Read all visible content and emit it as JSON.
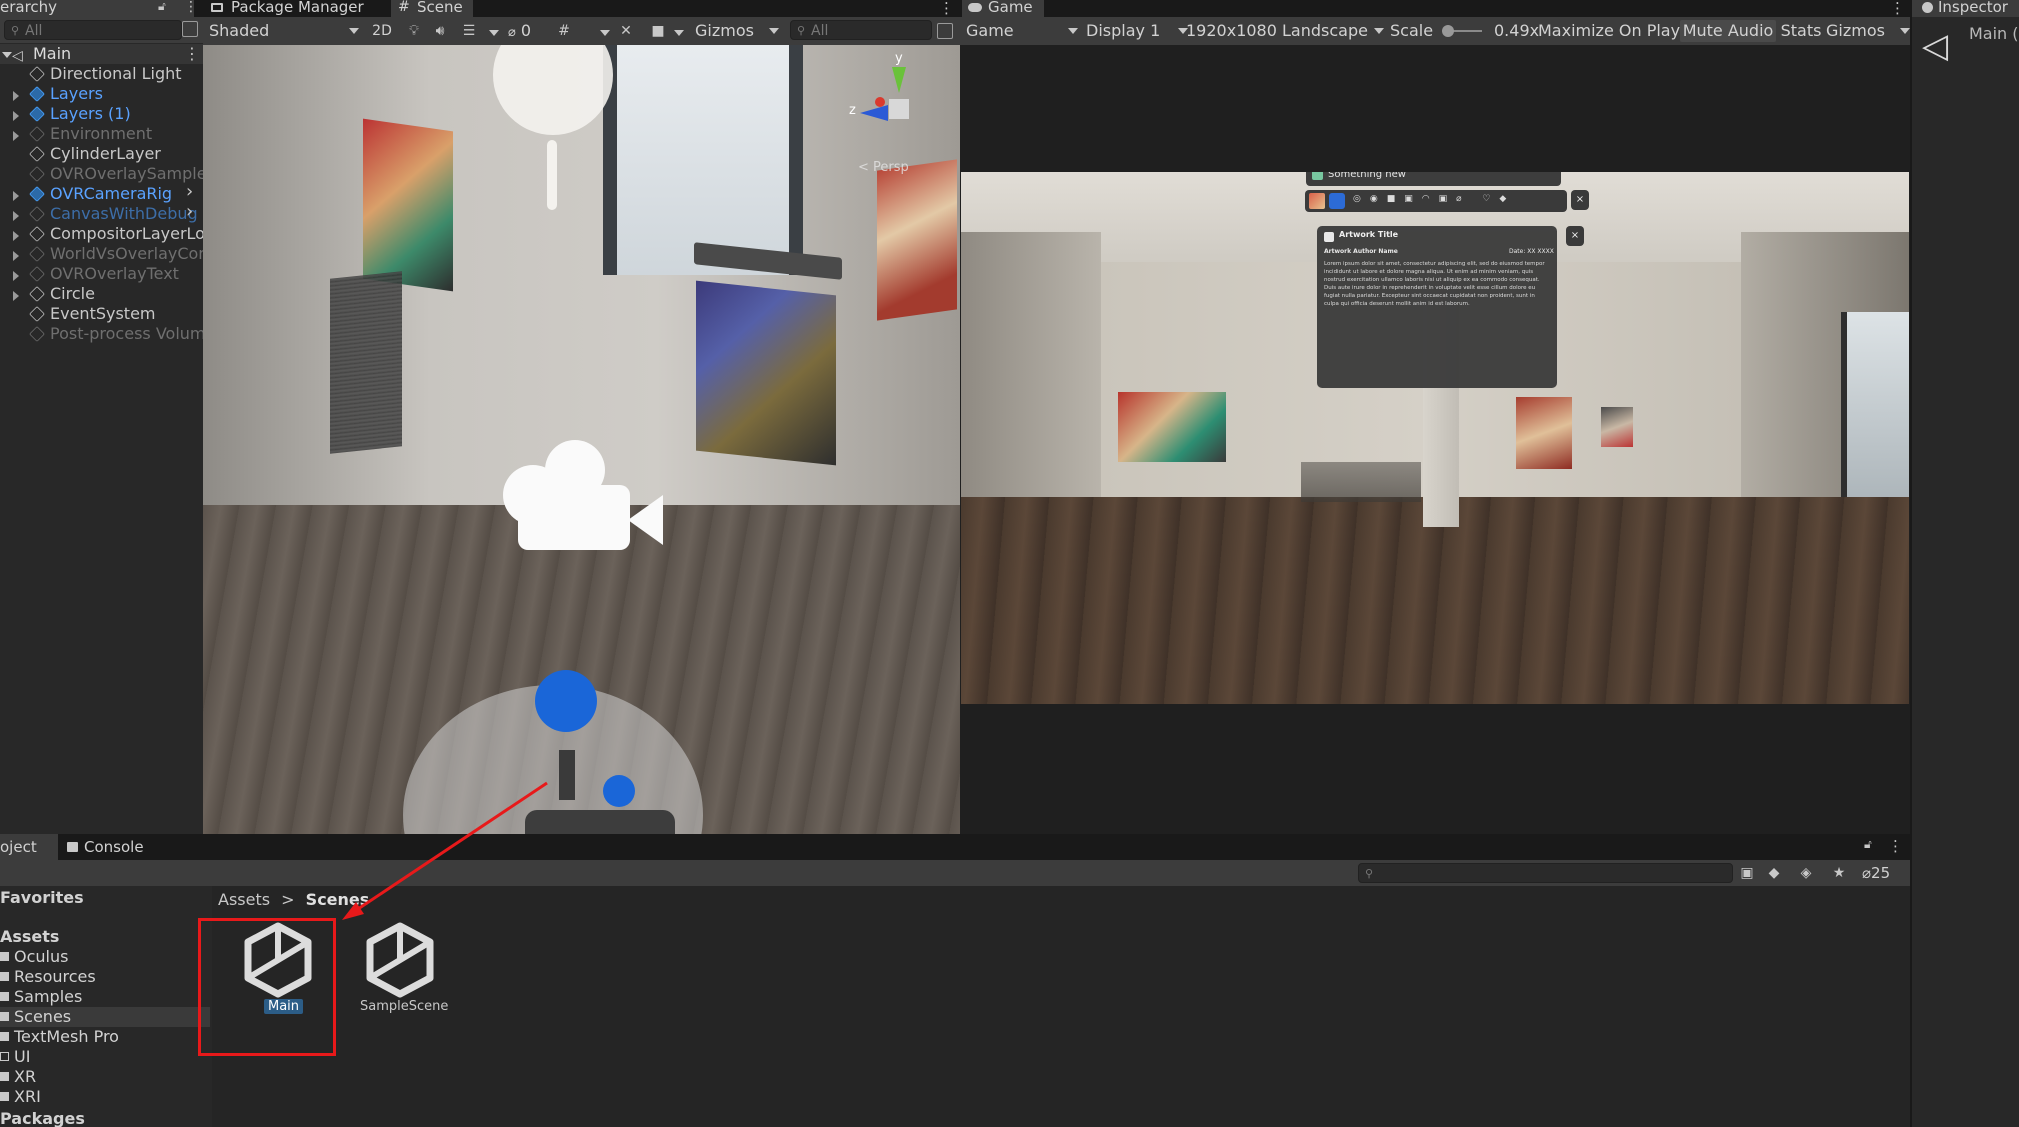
{
  "hierarchy": {
    "tab_label": "erarchy",
    "search_placeholder": "All",
    "scene_name": "Main",
    "items": [
      {
        "label": "Directional Light",
        "style": "normal",
        "foldout": false
      },
      {
        "label": "Layers",
        "style": "blue",
        "foldout": true
      },
      {
        "label": "Layers (1)",
        "style": "blue",
        "foldout": true
      },
      {
        "label": "Environment",
        "style": "dim",
        "foldout": true
      },
      {
        "label": "CylinderLayer",
        "style": "normal",
        "foldout": false
      },
      {
        "label": "OVROverlaySampleL",
        "style": "dim",
        "foldout": false
      },
      {
        "label": "OVRCameraRig",
        "style": "blue",
        "foldout": true
      },
      {
        "label": "CanvasWithDebug",
        "style": "bluedim",
        "foldout": true
      },
      {
        "label": "CompositorLayerLoa",
        "style": "normal",
        "foldout": true
      },
      {
        "label": "WorldVsOverlayComp",
        "style": "dim",
        "foldout": true
      },
      {
        "label": "OVROverlayText",
        "style": "dim",
        "foldout": true
      },
      {
        "label": "Circle",
        "style": "normal",
        "foldout": true
      },
      {
        "label": "EventSystem",
        "style": "normal",
        "foldout": false
      },
      {
        "label": "Post-process Volume",
        "style": "dim",
        "foldout": false
      }
    ]
  },
  "scene_view": {
    "tabs": [
      "Package Manager",
      "Scene"
    ],
    "shading_mode": "Shaded",
    "mode_2d_label": "2D",
    "hidden_count": "0",
    "gizmos_label": "Gizmos",
    "search_placeholder": "All",
    "persp_label": "< Persp",
    "axis_labels": {
      "y": "y",
      "z": "z"
    }
  },
  "game_view": {
    "tab_label": "Game",
    "mode": "Game",
    "display": "Display 1",
    "resolution": "1920x1080 Landscape",
    "scale_label": "Scale",
    "scale_value": "0.49x",
    "maximize_label": "Maximize On Play",
    "mute_label": "Mute Audio",
    "stats_label": "Stats",
    "gizmos_label": "Gizmos",
    "overlay": {
      "window_title": "Something new",
      "card_title": "Artwork Title",
      "author": "Artwork Author Name",
      "date": "Date: XX XXXX",
      "body": "Lorem ipsum dolor sit amet, consectetur adipiscing elit, sed do eiusmod tempor incididunt ut labore et dolore magna aliqua. Ut enim ad minim veniam, quis nostrud exercitation ullamco laboris nisi ut aliquip ex ea commodo consequat. Duis aute irure dolor in reprehenderit in voluptate velit esse cillum dolore eu fugiat nulla pariatur. Excepteur sint occaecat cupidatat non proident, sunt in culpa qui officia deserunt mollit anim id est laborum."
    }
  },
  "inspector": {
    "tab_label": "Inspector",
    "object_name": "Main ("
  },
  "project": {
    "tabs": [
      "oject",
      "Console"
    ],
    "favorites_label": "Favorites",
    "assets_label": "Assets",
    "folders": [
      "Oculus",
      "Resources",
      "Samples",
      "Scenes",
      "TextMesh Pro",
      "UI",
      "XR",
      "XRI"
    ],
    "selected_folder": "Scenes",
    "packages_label": "Packages",
    "breadcrumb": {
      "root": "Assets",
      "current": "Scenes"
    },
    "hidden_packages_count": "25",
    "assets": [
      {
        "name": "Main",
        "selected": true
      },
      {
        "name": "SampleScene",
        "selected": false
      }
    ]
  },
  "colors": {
    "annotation": "#e8191a",
    "selection": "#2c5d87",
    "prefab_blue": "#5aa2ff"
  }
}
